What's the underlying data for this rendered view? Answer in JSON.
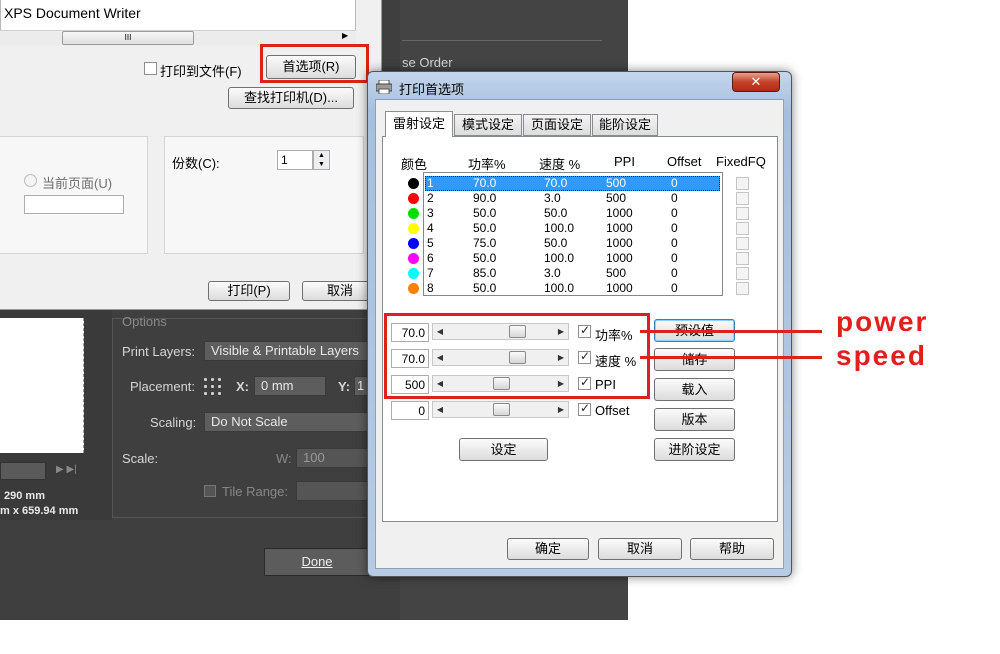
{
  "print_dialog": {
    "printer_name": "XPS Document Writer",
    "print_to_file": "打印到文件(F)",
    "preferences_button": "首选项(R)",
    "find_printer_button": "查找打印机(D)...",
    "current_page": "当前页面(U)",
    "copies_label": "份数(C):",
    "copies_value": "1",
    "print_button": "打印(P)",
    "cancel_button": "取消"
  },
  "dark_panel": {
    "rose_order": "se Order",
    "options": "Options",
    "print_layers_label": "Print Layers:",
    "print_layers_value": "Visible & Printable Layers",
    "placement_label": "Placement:",
    "x_label": "X:",
    "x_value": "0 mm",
    "y_label": "Y:",
    "y_value": "1",
    "scaling_label": "Scaling:",
    "scaling_value": "Do Not Scale",
    "scale_label": "Scale:",
    "w_label": "W:",
    "w_value": "100",
    "tile_range": "Tile Range:",
    "dim1": "290 mm",
    "dim2": "m x 659.94 mm",
    "done_button": "Done"
  },
  "prefs": {
    "title": "打印首选项",
    "close": "✕",
    "tabs": [
      "雷射设定",
      "模式设定",
      "页面设定",
      "能阶设定"
    ],
    "headers": {
      "color": "颜色",
      "power": "功率%",
      "speed": "速度 %",
      "ppi": "PPI",
      "offset": "Offset",
      "fixed": "FixedFQ"
    },
    "rows": [
      {
        "n": "1",
        "power": "70.0",
        "speed": "70.0",
        "ppi": "500",
        "offset": "0",
        "color": "#000000"
      },
      {
        "n": "2",
        "power": "90.0",
        "speed": "3.0",
        "ppi": "500",
        "offset": "0",
        "color": "#ff0000"
      },
      {
        "n": "3",
        "power": "50.0",
        "speed": "50.0",
        "ppi": "1000",
        "offset": "0",
        "color": "#00dd00"
      },
      {
        "n": "4",
        "power": "50.0",
        "speed": "100.0",
        "ppi": "1000",
        "offset": "0",
        "color": "#ffff00"
      },
      {
        "n": "5",
        "power": "75.0",
        "speed": "50.0",
        "ppi": "1000",
        "offset": "0",
        "color": "#0000ff"
      },
      {
        "n": "6",
        "power": "50.0",
        "speed": "100.0",
        "ppi": "1000",
        "offset": "0",
        "color": "#ff00ff"
      },
      {
        "n": "7",
        "power": "85.0",
        "speed": "3.0",
        "ppi": "500",
        "offset": "0",
        "color": "#00ffff"
      },
      {
        "n": "8",
        "power": "50.0",
        "speed": "100.0",
        "ppi": "1000",
        "offset": "0",
        "color": "#ff8000"
      }
    ],
    "controls": {
      "power_value": "70.0",
      "speed_value": "70.0",
      "ppi_value": "500",
      "offset_value": "0",
      "power_label": "功率%",
      "speed_label": "速度 %",
      "ppi_label": "PPI",
      "offset_label": "Offset"
    },
    "side_buttons": [
      "预设值",
      "储存",
      "载入",
      "版本",
      "进阶设定"
    ],
    "set_button": "设定",
    "ok_button": "确定",
    "cancel_button": "取消",
    "help_button": "帮助"
  },
  "annotations": {
    "power": "power",
    "speed": "speed"
  },
  "colors": {
    "annotation_red": "#e0201e",
    "selection_blue": "#3399ff",
    "dark_panel": "#424242"
  }
}
